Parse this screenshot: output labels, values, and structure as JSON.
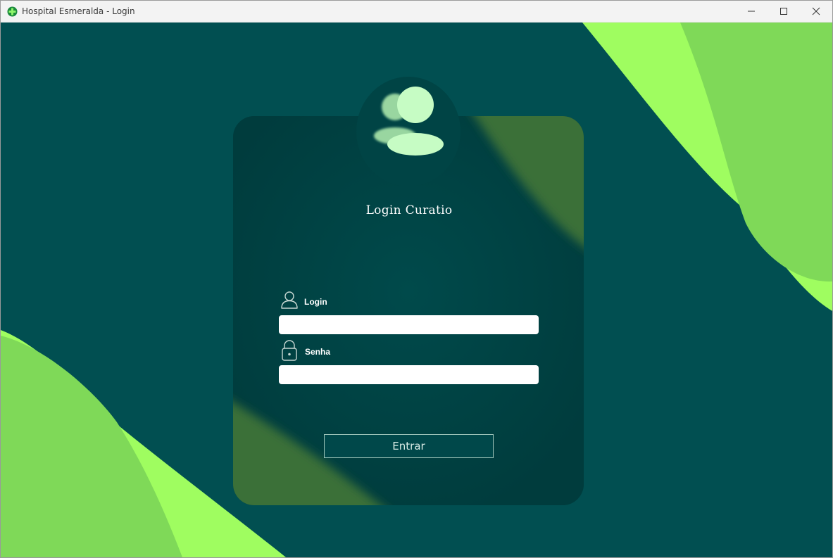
{
  "window": {
    "title": "Hospital Esmeralda - Login",
    "icon": "green-cross-icon",
    "controls": [
      "minimize-icon",
      "maximize-icon",
      "close-icon"
    ]
  },
  "colors": {
    "background": "#014f51",
    "card": "#003f40",
    "accent_light_green": "#9ffd60",
    "accent_mid_green": "#7fd958",
    "card_stripe_green": "#3a7037",
    "avatar_green": "#c6fcc4"
  },
  "form": {
    "avatar_icon": "users-icon",
    "title": "Login Curatio",
    "login": {
      "icon": "user-icon",
      "label": "Login",
      "value": "",
      "placeholder": ""
    },
    "password": {
      "icon": "lock-icon",
      "label": "Senha",
      "value": "",
      "placeholder": ""
    },
    "submit_label": "Entrar"
  }
}
